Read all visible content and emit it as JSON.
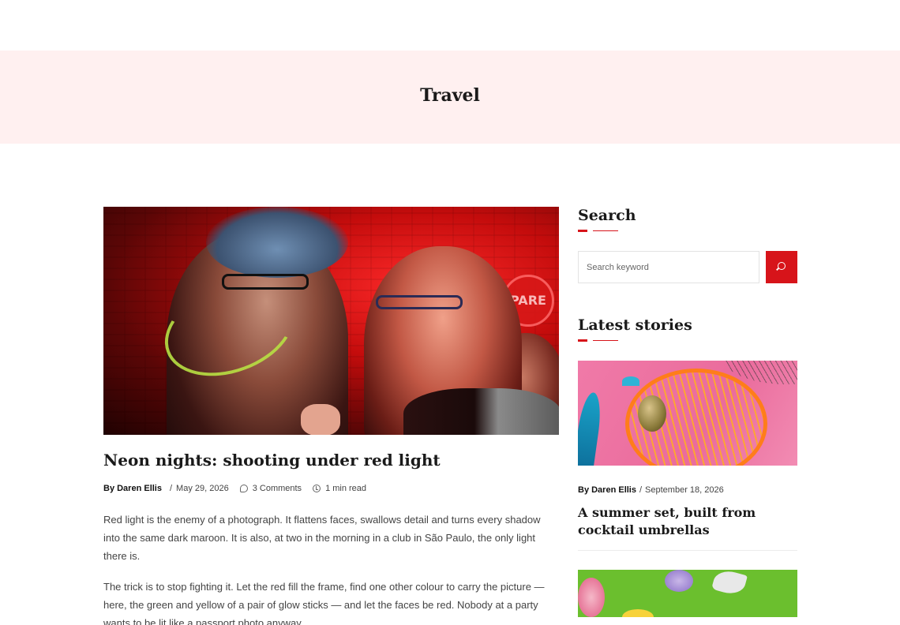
{
  "page_header": {
    "title": "Travel"
  },
  "post": {
    "title": "Neon nights: shooting under red light",
    "author": "By Daren Ellis",
    "date_sep": "/",
    "date": "May 29, 2026",
    "comments": "3 Comments",
    "read_time": "1 min read",
    "image_sign_text": "PARE",
    "paragraphs": [
      "Red light is the enemy of a photograph. It flattens faces, swallows detail and turns every shadow into the same dark maroon. It is also, at two in the morning in a club in São Paulo, the only light there is.",
      "The trick is to stop fighting it. Let the red fill the frame, find one other colour to carry the picture — here, the green and yellow of a pair of glow sticks — and let the faces be red. Nobody at a party wants to be lit like a passport photo anyway."
    ]
  },
  "sidebar": {
    "search": {
      "title": "Search",
      "placeholder": "Search keyword"
    },
    "latest": {
      "title": "Latest stories",
      "stories": [
        {
          "author": "By Daren Ellis",
          "sep": "/",
          "date": "September 18, 2026",
          "title": "A summer set, built from cocktail umbrellas"
        }
      ]
    }
  },
  "colors": {
    "accent": "#d7141a",
    "header_bg": "#fff0f0"
  },
  "icons": {
    "comment": "comment-icon",
    "clock": "clock-icon",
    "search": "search-icon"
  }
}
